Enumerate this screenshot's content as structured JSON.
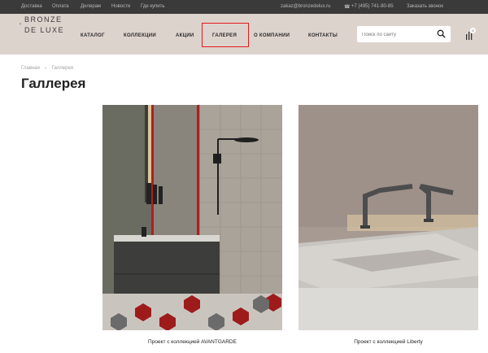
{
  "topbar": {
    "links": [
      "Доставка",
      "Оплата",
      "Дилерам",
      "Новости",
      "Где купить"
    ],
    "email": "zakaz@bronzedelux.ru",
    "phone": "+7 (495) 741-80-85",
    "callback": "Заказать звонок"
  },
  "logo": {
    "line1": "BRONZE",
    "line2": "DE LUXE"
  },
  "nav": {
    "items": [
      "КАТАЛОГ",
      "КОЛЛЕКЦИИ",
      "АКЦИИ",
      "ГАЛЕРЕЯ",
      "О КОМПАНИИ",
      "КОНТАКТЫ"
    ],
    "active_index": 3,
    "highlight_color": "#e21a1a"
  },
  "search": {
    "placeholder": "Поиск по сайту",
    "icon": "search-icon"
  },
  "cart": {
    "count": "0",
    "icon": "cart-icon"
  },
  "breadcrumb": {
    "home": "Главная",
    "separator": "–",
    "current": "Галлерея"
  },
  "page": {
    "title": "Галлерея"
  },
  "gallery": [
    {
      "caption": "Проект с коллекцией AVANTGARDE"
    },
    {
      "caption": "Проект с коллекцией Liberty"
    }
  ],
  "colors": {
    "topbar": "#3a3a3a",
    "header": "#ddd3cd",
    "accent_red": "#b21e1e"
  }
}
